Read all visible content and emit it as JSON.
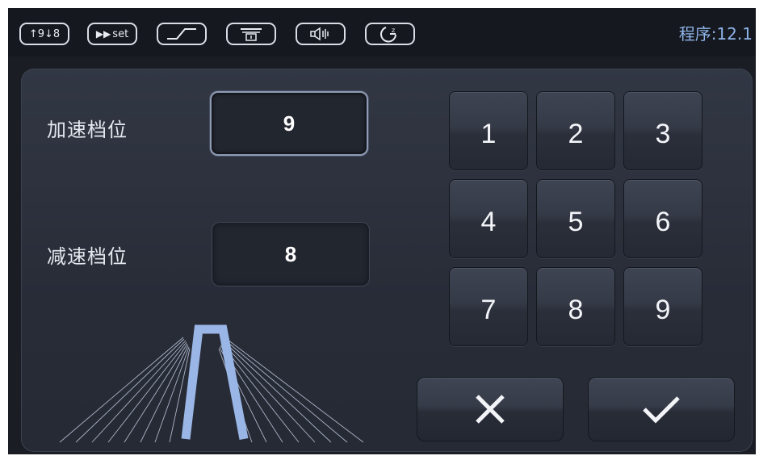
{
  "toolbar": {
    "sort_label": "↑9↓8",
    "set_label": "set",
    "program_prefix": "程序:",
    "program_value": "12.1",
    "program_text": "程序:12.1"
  },
  "form": {
    "accel_label": "加速档位",
    "accel_value": "9",
    "decel_label": "减速档位",
    "decel_value": "8"
  },
  "keypad": {
    "keys": [
      "1",
      "2",
      "3",
      "4",
      "5",
      "6",
      "7",
      "8",
      "9"
    ]
  },
  "icons": {
    "sort": "sort-up-down-icon",
    "fast_forward": "fast-forward-icon",
    "ramp": "ramp-profile-icon",
    "door": "door-icon",
    "speaker": "speaker-icon",
    "timer": "timer-icon",
    "cancel": "close-icon",
    "confirm": "check-icon",
    "pylon": "trapezoid-speed-graphic"
  },
  "colors": {
    "accent": "#8fb4ea",
    "pylon": "#9ab6e6",
    "background": "#1a1d24"
  }
}
